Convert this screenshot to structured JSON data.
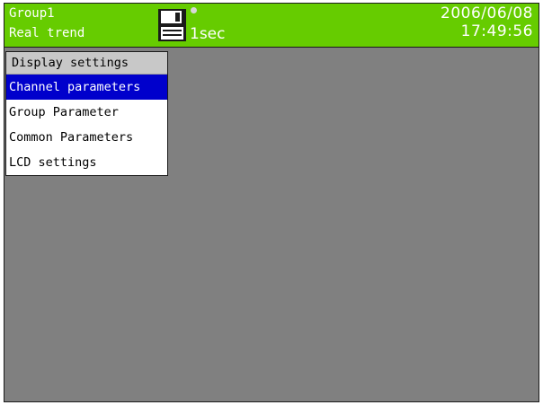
{
  "header": {
    "group_name": "Group1",
    "view_mode": "Real trend",
    "save_icon": "floppy-disk-icon",
    "status_indicator": "status-dot-icon",
    "interval": "1sec",
    "date": "2006/06/08",
    "time": "17:49:56",
    "bar_color": "#66cc00"
  },
  "menu": {
    "title": "Display settings",
    "items": [
      {
        "label": "Channel parameters",
        "selected": true
      },
      {
        "label": "Group Parameter",
        "selected": false
      },
      {
        "label": "Common Parameters",
        "selected": false
      },
      {
        "label": "LCD settings",
        "selected": false
      }
    ],
    "highlight_color": "#0000cc"
  },
  "background_color": "#808080"
}
